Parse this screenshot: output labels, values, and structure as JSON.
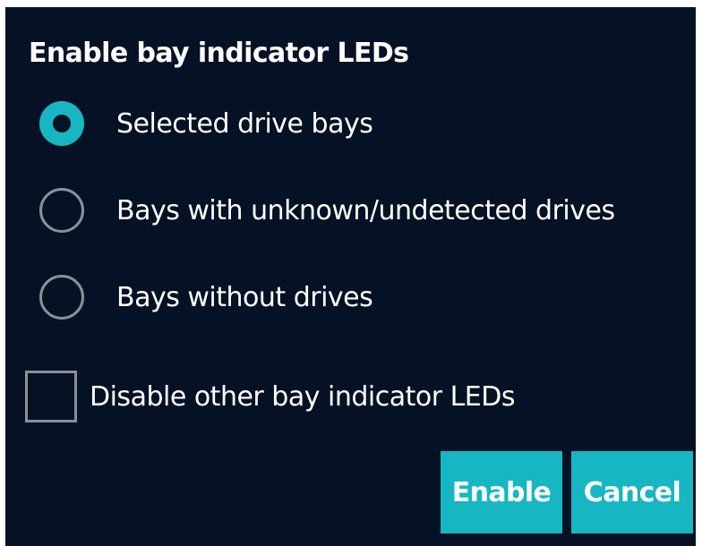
{
  "dialog": {
    "title": "Enable bay indicator LEDs",
    "options": [
      {
        "label": "Selected drive bays",
        "selected": true
      },
      {
        "label": "Bays with unknown/undetected drives",
        "selected": false
      },
      {
        "label": "Bays without drives",
        "selected": false
      }
    ],
    "disable_other": {
      "label": "Disable other bay indicator LEDs",
      "checked": false
    },
    "buttons": {
      "enable": "Enable",
      "cancel": "Cancel"
    }
  },
  "colors": {
    "background": "#051125",
    "accent": "#17b6c3",
    "control_border": "#8b8f97",
    "text": "#ffffff"
  }
}
